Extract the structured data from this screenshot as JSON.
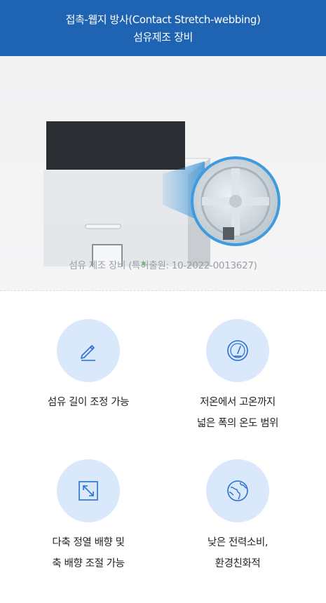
{
  "header": {
    "title_line1": "접촉-웹지 방사(Contact Stretch-webbing)",
    "title_line2": "섬유제조 장비"
  },
  "hero": {
    "caption": "섬유 제조 장비 (특허출원: 10-2022-0013627)"
  },
  "features": [
    {
      "icon": "pencil-icon",
      "lines": [
        "섬유 길이 조정 가능"
      ]
    },
    {
      "icon": "gauge-icon",
      "lines": [
        "저온에서 고온까지",
        "넓은 폭의 온도 범위"
      ]
    },
    {
      "icon": "diagonal-arrow-icon",
      "lines": [
        "다축 정열 배향 및",
        "축 배향 조절 가능"
      ]
    },
    {
      "icon": "globe-icon",
      "lines": [
        "낮은 전력소비,",
        "환경친화적"
      ]
    }
  ],
  "colors": {
    "header_bg": "#1f63b3",
    "icon_circle": "#d9e9fb",
    "icon_stroke": "#2a6fd0"
  }
}
